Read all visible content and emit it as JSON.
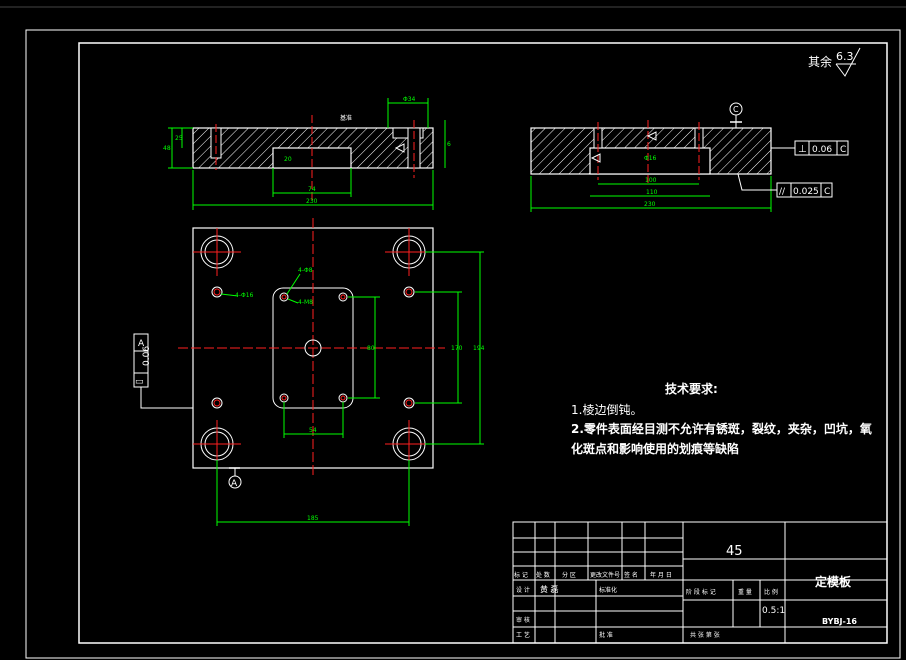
{
  "roughness": {
    "prefix": "其余",
    "value": "6.3"
  },
  "top_view_dims": {
    "overall_width": "230",
    "inner_width": "74",
    "height_left": "25",
    "height_total": "48",
    "slot_dim": "20",
    "top_right": "Φ34",
    "right_small": "6",
    "note_label": "基准"
  },
  "section_view": {
    "circle_label": "C",
    "width_total": "230",
    "width_mid": "110",
    "width_inner": "100",
    "small_dim": "Φ16",
    "tol_perp": {
      "symbol": "⊥",
      "value": "0.06",
      "datum": "C"
    },
    "tol_par": {
      "symbol": "//",
      "value": "0.025",
      "datum": "C"
    }
  },
  "plan_view": {
    "hole_label_1": "4-Φ16",
    "hole_label_2": "4-Φ8",
    "hole_label_3": "4-M8",
    "dim_vertical_inner": "80",
    "dim_vertical_mid": "170",
    "dim_vertical_outer": "194",
    "dim_bottom_inner": "54",
    "dim_bottom_outer": "185",
    "tol_flat": {
      "value": "0.06",
      "datum": "A",
      "symbol": "▭"
    },
    "datum_label": "A"
  },
  "requirements": {
    "title": "技术要求:",
    "items": [
      "1.棱边倒钝。",
      "2.零件表面经目测不允许有锈斑，裂纹，夹杂，凹坑，氧",
      "化斑点和影响使用的划痕等缺陷"
    ]
  },
  "title_block": {
    "material": "45",
    "part_name": "定模板",
    "drawing_no": "BYBJ-16",
    "scale": "0.5:1",
    "row_labels": [
      "标 记",
      "处 数",
      "分 区",
      "更改文件号",
      "签 名",
      "年 月 日"
    ],
    "cells": [
      "设 计",
      "黄 磊",
      "标准化",
      "审 核",
      "工 艺",
      "批 准"
    ],
    "stage_labels": [
      "阶 段 标 记",
      "重 量",
      "比 例"
    ],
    "sheet_labels": [
      "共 张 第 张"
    ]
  }
}
